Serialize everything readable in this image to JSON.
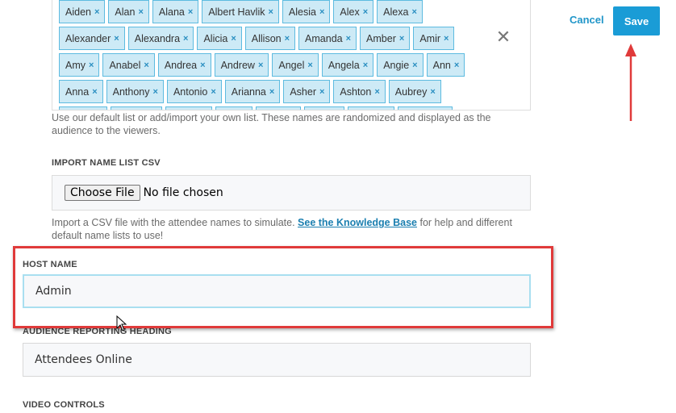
{
  "header": {
    "cancel_label": "Cancel",
    "save_label": "Save"
  },
  "names": {
    "rows": [
      [
        "Aiden",
        "Alan",
        "Alana",
        "Albert Havlik",
        "Alesia",
        "Alex",
        "Alexa"
      ],
      [
        "Alexander",
        "Alexandra",
        "Alicia",
        "Allison",
        "Amanda",
        "Amber",
        "Amir"
      ],
      [
        "Amy",
        "Anabel",
        "Andrea",
        "Andrew",
        "Angel",
        "Angela",
        "Angie",
        "Ann"
      ],
      [
        "Anna",
        "Anthony",
        "Antonio",
        "Arianna",
        "Asher",
        "Ashton",
        "Aubrey"
      ]
    ],
    "remove_glyph": "×",
    "clear_glyph": "✕",
    "help_line1": "Use our default list or add/import your own list. These names are randomized and displayed as the",
    "help_line2": "audience to the viewers."
  },
  "import": {
    "label": "IMPORT NAME LIST CSV",
    "button_label": "Choose File",
    "status": "No file chosen",
    "help_prefix": "Import a CSV file with the attendee names to simulate.",
    "link_text": "See the Knowledge Base",
    "help_suffix": "for help and different",
    "help_line2": "default name lists to use!"
  },
  "host": {
    "label": "HOST NAME",
    "value": "Admin"
  },
  "audience": {
    "label": "AUDIENCE REPORTING HEADING",
    "value": "Attendees Online"
  },
  "video": {
    "label": "VIDEO CONTROLS"
  },
  "colors": {
    "accent": "#1a9cd6",
    "tag_bg": "#cdeaf6",
    "annotation": "#e03a3a"
  },
  "icons": {
    "clear": "close-icon",
    "scroll": "scroll-down-icon",
    "annotation_arrow": "arrow-up-icon",
    "cursor": "mouse-cursor-icon"
  }
}
